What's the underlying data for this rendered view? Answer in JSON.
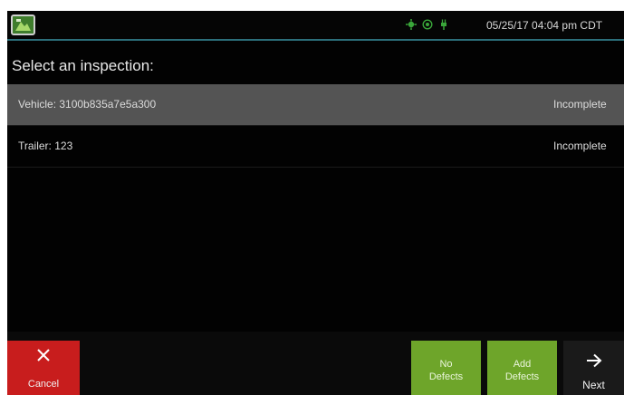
{
  "status_bar": {
    "logo_icon": "app-logo-icon",
    "icons": [
      "gps-icon",
      "connectivity-icon",
      "power-plug-icon"
    ],
    "icon_color": "#3aa63a",
    "datetime": "05/25/17 04:04 pm CDT"
  },
  "heading": "Select an inspection:",
  "inspections": [
    {
      "label": "Vehicle: 3100b835a7e5a300",
      "status": "Incomplete",
      "selected": true
    },
    {
      "label": "Trailer: 123",
      "status": "Incomplete",
      "selected": false
    }
  ],
  "buttons": {
    "cancel": {
      "label": "Cancel",
      "icon": "close-icon",
      "color": "#c81d1d"
    },
    "no_defects": {
      "label": "No\nDefects",
      "color": "#6ea52a"
    },
    "add_defects": {
      "label": "Add\nDefects",
      "color": "#6ea52a"
    },
    "next": {
      "label": "Next",
      "icon": "arrow-right-icon"
    }
  }
}
